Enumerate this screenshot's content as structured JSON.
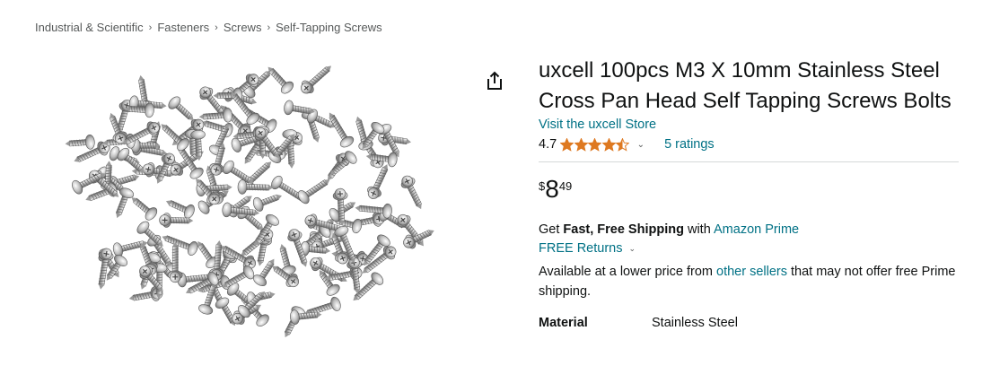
{
  "breadcrumb": {
    "items": [
      "Industrial & Scientific",
      "Fasteners",
      "Screws",
      "Self-Tapping Screws"
    ],
    "separator": "›"
  },
  "product": {
    "title": "uxcell 100pcs M3 X 10mm Stainless Steel Cross Pan Head Self Tapping Screws Bolts",
    "store_link": "Visit the uxcell Store",
    "rating_value": "4.7",
    "rating_stars": 4.5,
    "ratings_count": "5 ratings",
    "price": {
      "symbol": "$",
      "whole": "8",
      "fraction": "49"
    },
    "shipping": {
      "prefix": "Get ",
      "bold": "Fast, Free Shipping",
      "middle": " with ",
      "prime_link": "Amazon Prime"
    },
    "returns": "FREE Returns",
    "lower_price": {
      "prefix": "Available at a lower price from ",
      "link": "other sellers",
      "suffix": " that may not offer free Prime shipping."
    },
    "attributes": [
      {
        "key": "Material",
        "value": "Stainless Steel"
      }
    ]
  },
  "colors": {
    "link": "#007185",
    "star": "#de7921",
    "text": "#0f1111",
    "muted": "#565959"
  },
  "icons": {
    "share": "share-icon",
    "chevron": "chevron-down-icon",
    "star": "star-icon"
  }
}
